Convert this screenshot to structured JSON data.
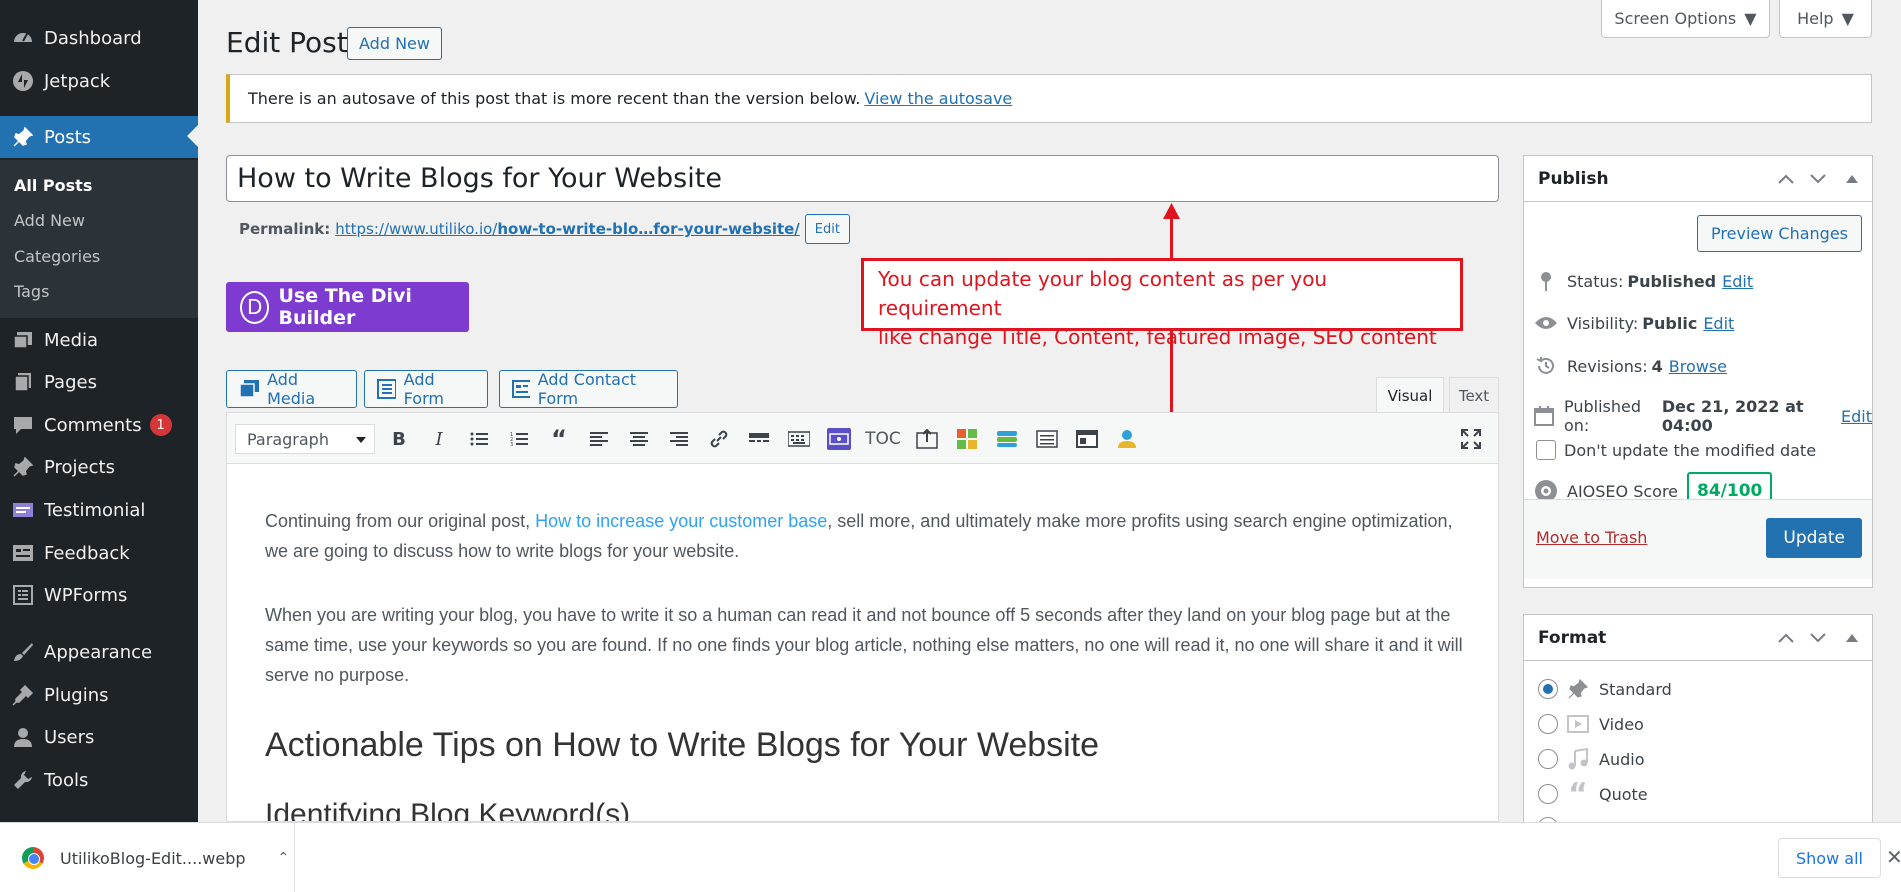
{
  "sidebar": {
    "items": [
      {
        "label": "Dashboard",
        "icon": "dashboard-icon"
      },
      {
        "label": "Jetpack",
        "icon": "jetpack-icon"
      },
      {
        "label": "Posts",
        "icon": "pin-icon"
      },
      {
        "label": "Media",
        "icon": "media-icon"
      },
      {
        "label": "Pages",
        "icon": "pages-icon"
      },
      {
        "label": "Comments",
        "icon": "comments-icon",
        "badge": "1"
      },
      {
        "label": "Projects",
        "icon": "pin-icon"
      },
      {
        "label": "Testimonial",
        "icon": "testimonial-icon"
      },
      {
        "label": "Feedback",
        "icon": "feedback-icon"
      },
      {
        "label": "WPForms",
        "icon": "wpforms-icon"
      },
      {
        "label": "Appearance",
        "icon": "brush-icon"
      },
      {
        "label": "Plugins",
        "icon": "plugin-icon"
      },
      {
        "label": "Users",
        "icon": "user-icon"
      },
      {
        "label": "Tools",
        "icon": "wrench-icon"
      }
    ],
    "submenu": [
      "All Posts",
      "Add New",
      "Categories",
      "Tags"
    ]
  },
  "top": {
    "screen_options": "Screen Options",
    "help": "Help"
  },
  "header": {
    "title": "Edit Post",
    "add_new": "Add New"
  },
  "notice": {
    "text": "There is an autosave of this post that is more recent than the version below.",
    "link": "View the autosave"
  },
  "post": {
    "title": "How to Write Blogs for Your Website",
    "permalink_label": "Permalink:",
    "permalink_base": "https://www.utiliko.io/",
    "permalink_slug": "how-to-write-blo…for-your-website/",
    "permalink_edit": "Edit"
  },
  "divi": {
    "label": "Use The Divi Builder",
    "logo": "D"
  },
  "annotation": {
    "line1": "You can update your blog content as per you requirement",
    "line2": "like change Title, Content, featured image, SEO content"
  },
  "media_buttons": {
    "add_media": "Add Media",
    "add_form": "Add Form",
    "add_contact_form": "Add Contact Form"
  },
  "editor_tabs": {
    "visual": "Visual",
    "text": "Text"
  },
  "toolbar": {
    "format": "Paragraph",
    "toc": "TOC"
  },
  "content": {
    "p1_before": "Continuing from our original post, ",
    "p1_link": "How to increase your customer base",
    "p1_after": ", sell more, and ultimately make more profits using search engine optimization, we are going to discuss how to write blogs for your website.",
    "p2": "When you are writing your blog, you have to write it so a human can read it and not bounce off 5 seconds after they land on your blog page but at the same time, use your keywords so you are found. If no one finds your blog article, nothing else matters, no one will read it, no one will share it and it will serve no purpose.",
    "h2": "Actionable Tips on How to Write Blogs for Your Website",
    "h3": "Identifying Blog Keyword(s)"
  },
  "publish": {
    "title": "Publish",
    "preview": "Preview Changes",
    "status_label": "Status:",
    "status_value": "Published",
    "status_edit": "Edit",
    "visibility_label": "Visibility:",
    "visibility_value": "Public",
    "visibility_edit": "Edit",
    "revisions_label": "Revisions:",
    "revisions_value": "4",
    "revisions_link": "Browse",
    "published_label": "Published on:",
    "published_value": "Dec 21, 2022 at 04:00",
    "published_edit": "Edit",
    "dont_update": "Don't update the modified date",
    "aioseo_label": "AIOSEO Score",
    "aioseo_score": "84/100",
    "trash": "Move to Trash",
    "update": "Update"
  },
  "format": {
    "title": "Format",
    "options": [
      "Standard",
      "Video",
      "Audio",
      "Quote"
    ],
    "selected": "Standard"
  },
  "download": {
    "filename": "UtilikoBlog-Edit....webp",
    "show_all": "Show all"
  },
  "colors": {
    "accent": "#2271b1",
    "sidebar": "#1d2327",
    "divi": "#7e3bd0",
    "annotation": "#e0141e",
    "score": "#00aa63"
  }
}
